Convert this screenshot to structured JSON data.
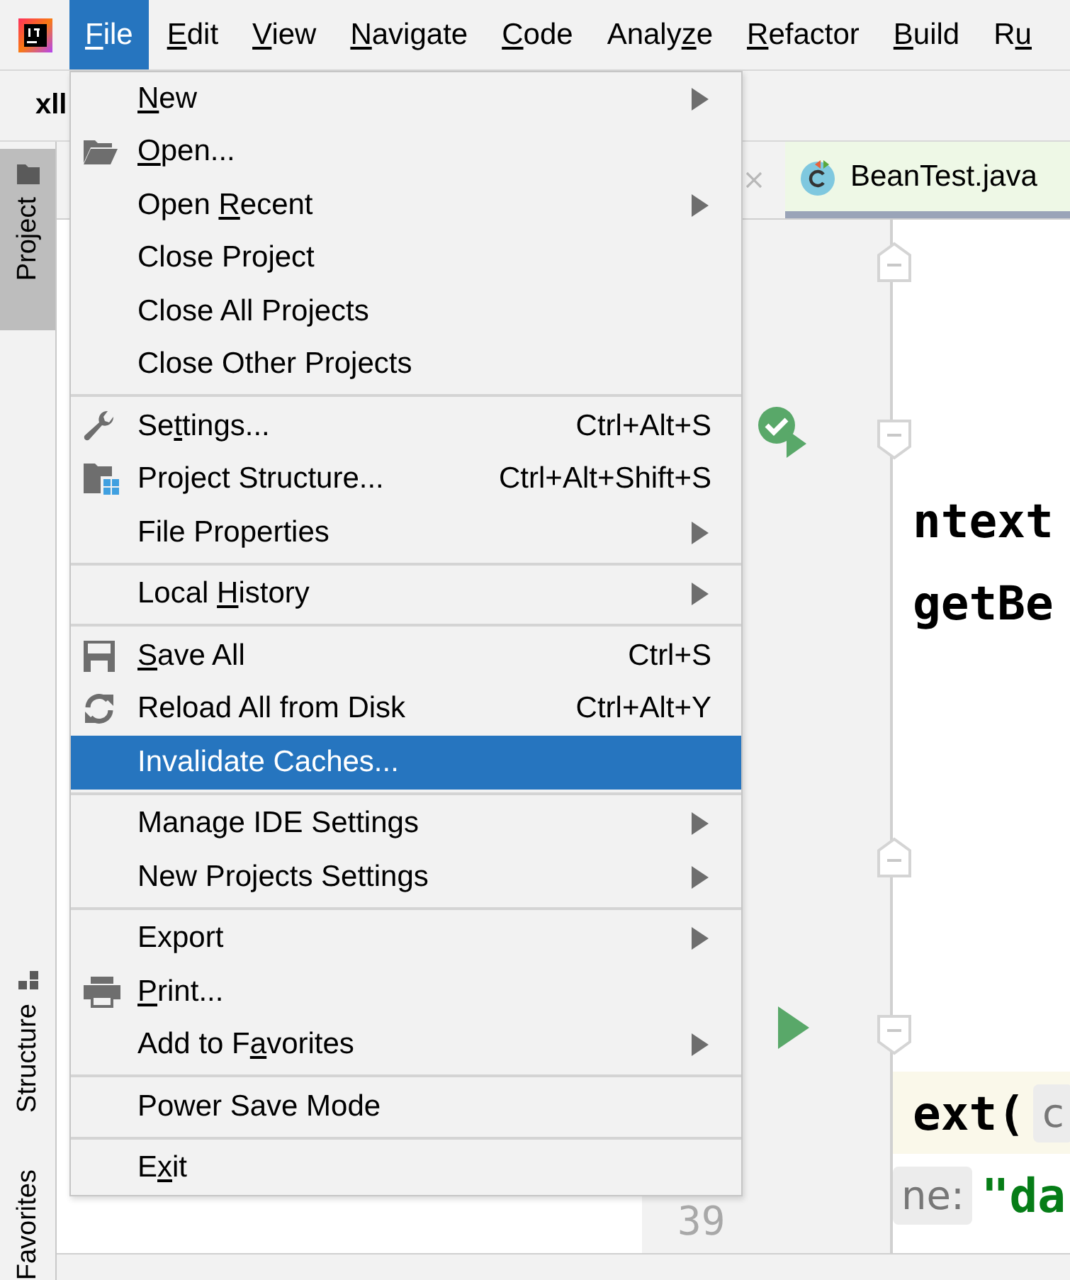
{
  "menu_bar": [
    {
      "key": "F",
      "post": "ile",
      "selected": true
    },
    {
      "key": "E",
      "post": "dit",
      "selected": false
    },
    {
      "key": "V",
      "post": "iew",
      "selected": false
    },
    {
      "key": "N",
      "post": "avigate",
      "selected": false
    },
    {
      "key": "C",
      "post": "ode",
      "selected": false
    },
    {
      "pre": "Analy",
      "key": "z",
      "post": "e",
      "selected": false
    },
    {
      "key": "R",
      "post": "efactor",
      "selected": false
    },
    {
      "key": "B",
      "post": "uild",
      "selected": false
    },
    {
      "pre": "R",
      "key": "u",
      "selected": false
    }
  ],
  "toolbar": {
    "project": "xll"
  },
  "side_tabs": [
    {
      "label": "Project",
      "selected": true
    },
    {
      "label": "Structure",
      "selected": false
    },
    {
      "label": "Favorites",
      "selected": false
    }
  ],
  "editor_tab": {
    "label": "BeanTest.java"
  },
  "editor": {
    "line_number": "39",
    "code_lines": [
      {
        "text": "ntext",
        "highlighted": false
      },
      {
        "text": "getBe",
        "highlighted": false
      },
      {
        "text": "ext(",
        "hint": "c",
        "highlighted": true
      },
      {
        "hint": "ne:",
        "string": "\"da",
        "highlighted": false
      }
    ]
  },
  "file_menu": {
    "items": [
      {
        "kind": "item",
        "key": "N",
        "post": "ew",
        "submenu": true,
        "selected": false
      },
      {
        "kind": "item",
        "key": "O",
        "post": "pen...",
        "submenu": false,
        "selected": false
      },
      {
        "kind": "item",
        "pre": "Open ",
        "key": "R",
        "post": "ecent",
        "submenu": true,
        "selected": false
      },
      {
        "kind": "item",
        "pre": "Close Project",
        "submenu": false,
        "selected": false
      },
      {
        "kind": "item",
        "pre": "Close All Projects",
        "submenu": false,
        "selected": false
      },
      {
        "kind": "item",
        "pre": "Close Other Projects",
        "submenu": false,
        "selected": false
      },
      {
        "kind": "separator"
      },
      {
        "kind": "item",
        "pre": "Se",
        "key": "t",
        "post": "tings...",
        "shortcut": "Ctrl+Alt+S",
        "submenu": false,
        "selected": false
      },
      {
        "kind": "item",
        "pre": "Project Structure...",
        "shortcut": "Ctrl+Alt+Shift+S",
        "submenu": false,
        "selected": false
      },
      {
        "kind": "item",
        "pre": "File Properties",
        "submenu": true,
        "selected": false
      },
      {
        "kind": "separator"
      },
      {
        "kind": "item",
        "pre": "Local ",
        "key": "H",
        "post": "istory",
        "submenu": true,
        "selected": false
      },
      {
        "kind": "separator"
      },
      {
        "kind": "item",
        "key": "S",
        "post": "ave All",
        "shortcut": "Ctrl+S",
        "submenu": false,
        "selected": false
      },
      {
        "kind": "item",
        "pre": "Reload All from Disk",
        "shortcut": "Ctrl+Alt+Y",
        "submenu": false,
        "selected": false
      },
      {
        "kind": "item",
        "pre": "Invalidate Caches...",
        "submenu": false,
        "selected": true
      },
      {
        "kind": "separator"
      },
      {
        "kind": "item",
        "pre": "Manage IDE Settings",
        "submenu": true,
        "selected": false
      },
      {
        "kind": "item",
        "pre": "New Projects Settings",
        "submenu": true,
        "selected": false
      },
      {
        "kind": "separator"
      },
      {
        "kind": "item",
        "pre": "Export",
        "submenu": true,
        "selected": false
      },
      {
        "kind": "item",
        "key": "P",
        "post": "rint...",
        "submenu": false,
        "selected": false
      },
      {
        "kind": "item",
        "pre": "Add to F",
        "key": "a",
        "post": "vorites",
        "submenu": true,
        "selected": false
      },
      {
        "kind": "separator"
      },
      {
        "kind": "item",
        "pre": "Power Save Mode",
        "submenu": false,
        "selected": false
      },
      {
        "kind": "separator"
      },
      {
        "kind": "item",
        "pre": "E",
        "key": "x",
        "post": "it",
        "submenu": false,
        "selected": false
      }
    ]
  }
}
